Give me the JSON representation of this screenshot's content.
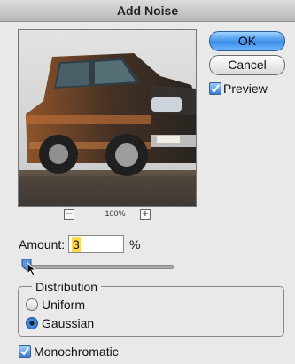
{
  "window": {
    "title": "Add Noise"
  },
  "buttons": {
    "ok": "OK",
    "cancel": "Cancel"
  },
  "preview": {
    "label": "Preview",
    "checked": true
  },
  "zoom": {
    "level": "100%",
    "minus": "−",
    "plus": "+"
  },
  "amount": {
    "label": "Amount:",
    "value": "3",
    "unit": "%",
    "slider_fraction": 0.03
  },
  "distribution": {
    "title": "Distribution",
    "options": [
      "Uniform",
      "Gaussian"
    ],
    "selected": "Gaussian"
  },
  "monochromatic": {
    "label": "Monochromatic",
    "checked": true
  },
  "colors": {
    "ok_button": "#3a8ee6",
    "input_highlight": "#ffd84a",
    "checkbox": "#3a7bd5"
  }
}
